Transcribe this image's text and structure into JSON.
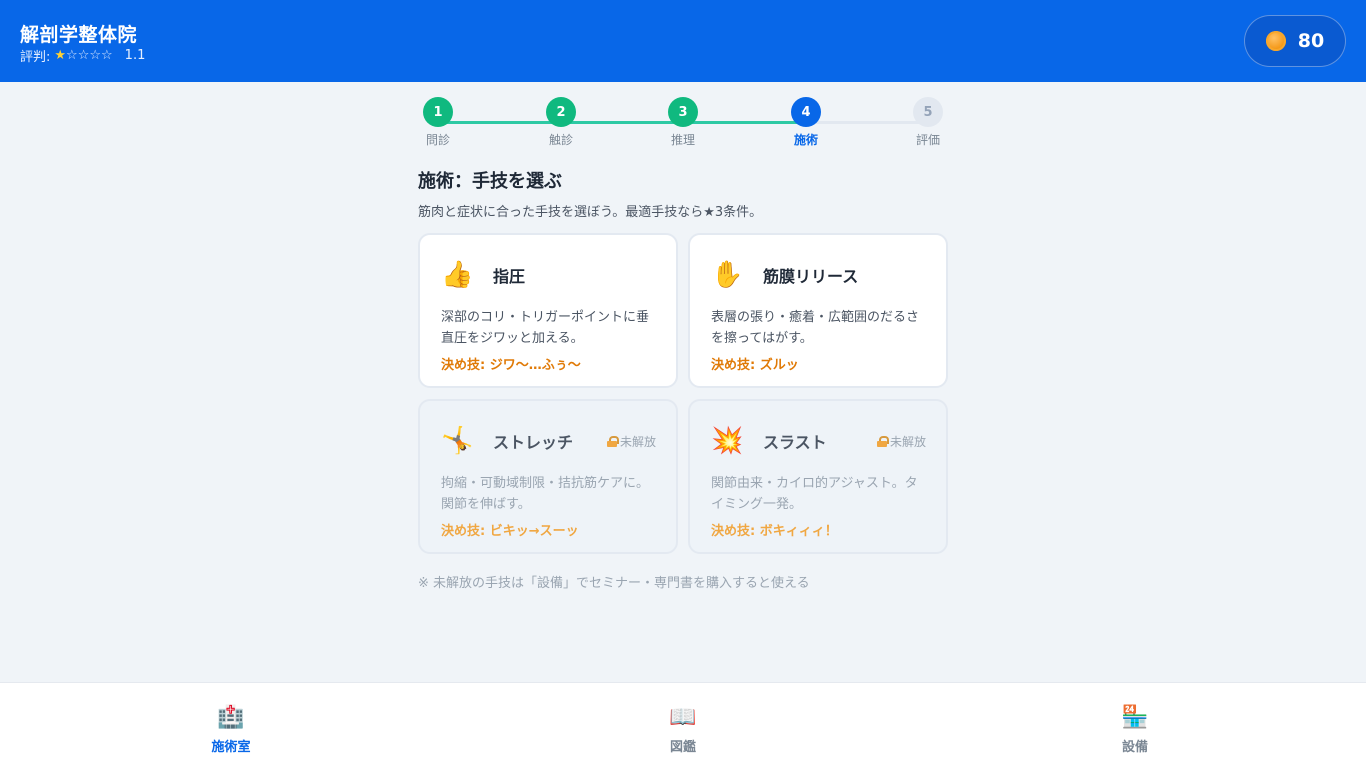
{
  "header": {
    "clinic_name": "解剖学整体院",
    "rating_label": "評判:",
    "rating_value": "1.1",
    "rating_stars": 1,
    "rating_max": 5,
    "coins": "80",
    "accent_color": "#0867e8"
  },
  "stepper": {
    "current": 4,
    "steps": [
      {
        "num": "1",
        "label": "問診",
        "state": "done"
      },
      {
        "num": "2",
        "label": "触診",
        "state": "done"
      },
      {
        "num": "3",
        "label": "推理",
        "state": "done"
      },
      {
        "num": "4",
        "label": "施術",
        "state": "current"
      },
      {
        "num": "5",
        "label": "評価",
        "state": "todo"
      }
    ]
  },
  "section": {
    "title": "施術：手技を選ぶ",
    "description": "筋肉と症状に合った手技を選ぼう。最適手技なら★3条件。"
  },
  "techniques": [
    {
      "icon": "👍",
      "icon_name": "thumbs-up-icon",
      "title": "指圧",
      "description": "深部のコリ・トリガーポイントに垂直圧をジワッと加える。",
      "special": "決め技: ジワ〜…ふぅ〜",
      "locked": false
    },
    {
      "icon": "✋",
      "icon_name": "raised-hand-icon",
      "title": "筋膜リリース",
      "description": "表層の張り・癒着・広範囲のだるさを擦ってはがす。",
      "special": "決め技: ズルッ",
      "locked": false
    },
    {
      "icon": "🤸",
      "icon_name": "cartwheel-icon",
      "title": "ストレッチ",
      "description": "拘縮・可動域制限・拮抗筋ケアに。関節を伸ばす。",
      "special": "決め技: ビキッ→スーッ",
      "locked": true,
      "lock_label": "未解放"
    },
    {
      "icon": "💥",
      "icon_name": "collision-icon",
      "title": "スラスト",
      "description": "関節由来・カイロ的アジャスト。タイミング一発。",
      "special": "決め技: ボキィィィ！",
      "locked": true,
      "lock_label": "未解放"
    }
  ],
  "footnote": "※ 未解放の手技は「設備」でセミナー・専門書を購入すると使える",
  "nav": {
    "items": [
      {
        "icon": "🏥",
        "icon_name": "clinic-room-icon",
        "label": "施術室",
        "active": true
      },
      {
        "icon": "📖",
        "icon_name": "book-icon",
        "label": "図鑑",
        "active": false
      },
      {
        "icon": "🏪",
        "icon_name": "shop-icon",
        "label": "設備",
        "active": false
      }
    ]
  }
}
